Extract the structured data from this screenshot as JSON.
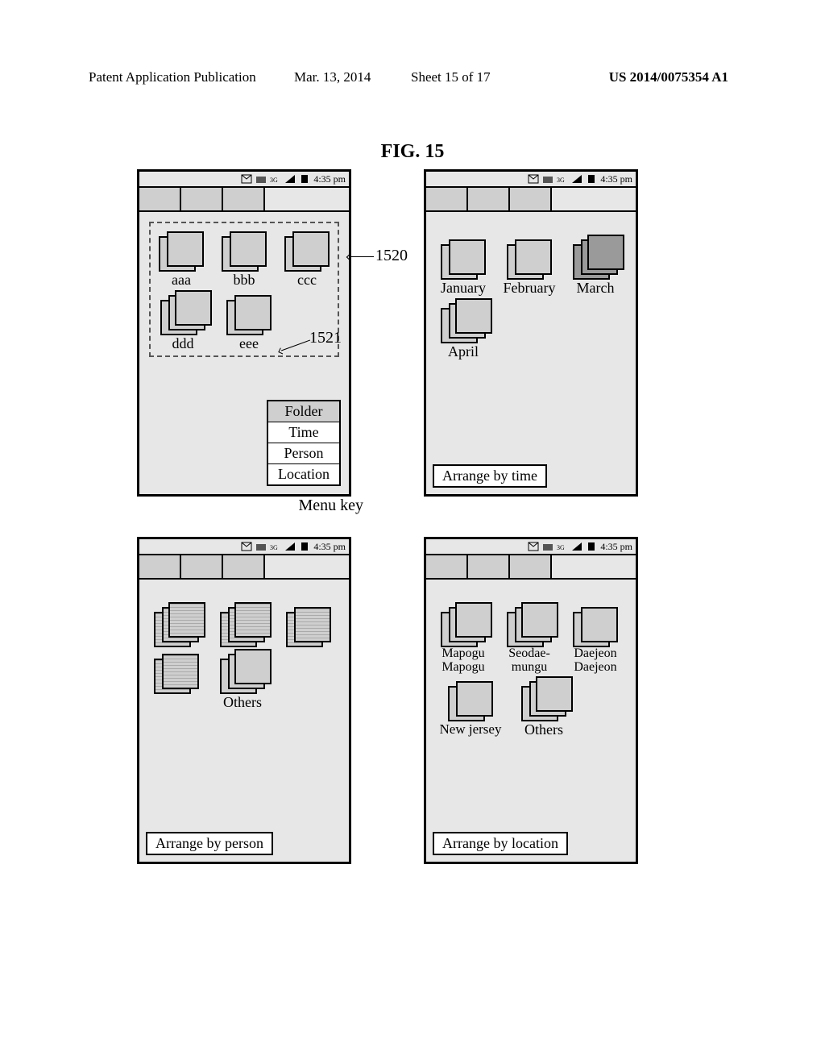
{
  "header": {
    "publication": "Patent Application Publication",
    "date": "Mar. 13, 2014",
    "sheet": "Sheet 15 of 17",
    "number": "US 2014/0075354 A1"
  },
  "figure_title": "FIG. 15",
  "status": {
    "time": "4:35 pm"
  },
  "callouts": {
    "c1520": "1520",
    "c1521": "1521"
  },
  "menu_key": "Menu key",
  "menu_items": [
    "Folder",
    "Time",
    "Person",
    "Location"
  ],
  "screens": {
    "tl": {
      "folders_r1": [
        "aaa",
        "bbb",
        "ccc"
      ],
      "folders_r2": [
        "ddd",
        "eee"
      ]
    },
    "tr": {
      "folders_r1": [
        "January",
        "February",
        "March"
      ],
      "folders_r2": [
        "April"
      ],
      "footer": "Arrange by time"
    },
    "bl": {
      "folders_r1": [
        "",
        "",
        ""
      ],
      "folders_r2": [
        "",
        "Others"
      ],
      "footer": "Arrange by person"
    },
    "br": {
      "folders_r1_l1": [
        "Mapogu",
        "Seodae-",
        "Daejeon"
      ],
      "folders_r1_l2": [
        "Mapogu",
        "mungu",
        "Daejeon"
      ],
      "folders_r2": [
        "New jersey",
        "Others"
      ],
      "footer": "Arrange by location"
    }
  }
}
